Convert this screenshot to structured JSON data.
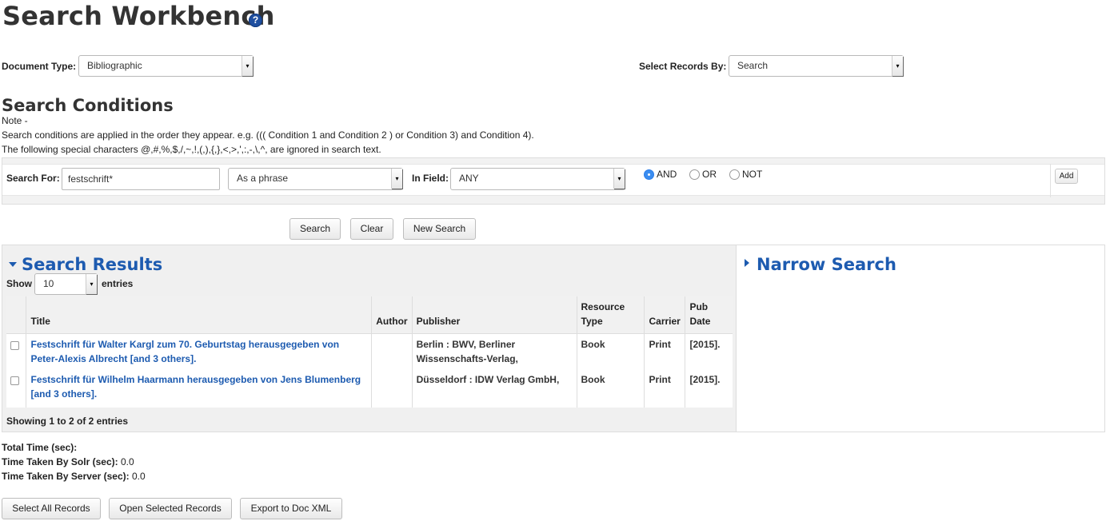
{
  "page": {
    "title": "Search Workbench",
    "help_icon": "?"
  },
  "filters": {
    "document_type_label": "Document Type:",
    "document_type_value": "Bibliographic",
    "select_records_label": "Select Records By:",
    "select_records_value": "Search"
  },
  "conditions": {
    "heading": "Search Conditions",
    "note_label": "Note -",
    "note_line1": "Search conditions are applied in the order they appear. e.g. ((( Condition 1 and Condition 2 ) or Condition 3) and Condition 4).",
    "note_line2": "The following special characters @,#,%,$,/,~,!,(,),{,},<,>,',:,-,\\,^, are ignored in search text.",
    "search_for_label": "Search For:",
    "search_for_value": "festschrift*",
    "match_type": "As a phrase",
    "in_field_label": "In Field:",
    "in_field_value": "ANY",
    "operators": [
      "AND",
      "OR",
      "NOT"
    ],
    "selected_operator": "AND",
    "add_label": "Add"
  },
  "actions": {
    "search": "Search",
    "clear": "Clear",
    "new_search": "New Search"
  },
  "results": {
    "heading": "Search Results",
    "show_label": "Show",
    "page_size": "10",
    "entries_label": "entries",
    "columns": [
      "Title",
      "Author",
      "Publisher",
      "Resource Type",
      "Carrier",
      "Pub Date"
    ],
    "column_title": "Title",
    "column_author": "Author",
    "column_publisher": "Publisher",
    "column_resource_l1": "Resource",
    "column_resource_l2": "Type",
    "column_carrier": "Carrier",
    "column_pub_l1": "Pub",
    "column_pub_l2": "Date",
    "rows": [
      {
        "title": "Festschrift für Walter Kargl zum 70. Geburtstag herausgegeben von Peter-Alexis Albrecht [and 3 others].",
        "author": "",
        "publisher": "Berlin : BWV, Berliner Wissenschafts-Verlag,",
        "resource_type": "Book",
        "carrier": "Print",
        "pub_date": "[2015]."
      },
      {
        "title": "Festschrift für Wilhelm Haarmann herausgegeben von Jens Blumenberg [and 3 others].",
        "author": "",
        "publisher": "Düsseldorf : IDW Verlag GmbH,",
        "resource_type": "Book",
        "carrier": "Print",
        "pub_date": "[2015]."
      }
    ],
    "summary": "Showing 1 to 2 of 2 entries"
  },
  "narrow": {
    "heading": "Narrow Search"
  },
  "stats": {
    "total_time_label": "Total Time (sec):",
    "total_time_value": "",
    "solr_label": "Time Taken By Solr (sec):",
    "solr_value": "0.0",
    "server_label": "Time Taken By Server (sec):",
    "server_value": "0.0"
  },
  "bottom_actions": {
    "select_all": "Select All Records",
    "open_selected": "Open Selected Records",
    "export": "Export to Doc XML"
  },
  "colors": {
    "accent_blue": "#1d5bb0",
    "radio_blue": "#3b8df0"
  }
}
